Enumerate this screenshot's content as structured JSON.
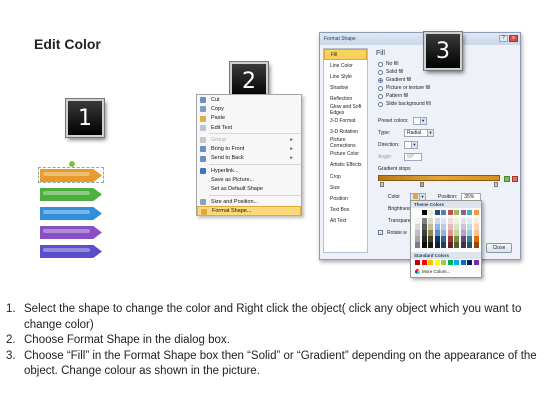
{
  "title": "Edit Color",
  "steps": [
    "1",
    "2",
    "3"
  ],
  "shapes": {
    "colors": [
      "#e89a2c",
      "#4caf3e",
      "#2f8fd8",
      "#8a4fc4",
      "#5a4fc8"
    ]
  },
  "context_menu": {
    "items": [
      {
        "label": "Cut",
        "icon_color": "#6a8fc7",
        "disabled": false,
        "submenu": false,
        "highlight": false
      },
      {
        "label": "Copy",
        "icon_color": "#7d9cc8",
        "disabled": false,
        "submenu": false,
        "highlight": false
      },
      {
        "label": "Paste",
        "icon_color": "#d9b14a",
        "disabled": false,
        "submenu": false,
        "highlight": false
      },
      {
        "label": "Edit Text",
        "icon_color": "#b7c4d8",
        "disabled": false,
        "submenu": false,
        "highlight": false
      },
      {
        "label": "Group",
        "icon_color": "#c8c8c8",
        "disabled": true,
        "submenu": true,
        "highlight": false
      },
      {
        "label": "Bring to Front",
        "icon_color": "#6d8fbf",
        "disabled": false,
        "submenu": true,
        "highlight": false
      },
      {
        "label": "Send to Back",
        "icon_color": "#6d8fbf",
        "disabled": false,
        "submenu": true,
        "highlight": false
      },
      {
        "label": "Hyperlink...",
        "icon_color": "#3b73c6",
        "disabled": false,
        "submenu": false,
        "highlight": false
      },
      {
        "label": "Save as Picture...",
        "icon_color": "",
        "disabled": false,
        "submenu": false,
        "highlight": false
      },
      {
        "label": "Set as Default Shape",
        "icon_color": "",
        "disabled": false,
        "submenu": false,
        "highlight": false
      },
      {
        "label": "Size and Position...",
        "icon_color": "#8aa3c5",
        "disabled": false,
        "submenu": false,
        "highlight": false
      },
      {
        "label": "Format Shape...",
        "icon_color": "#e1a83a",
        "disabled": false,
        "submenu": false,
        "highlight": true
      }
    ]
  },
  "dialog": {
    "title": "Format Shape",
    "close_glyph": "x",
    "categories": [
      "Fill",
      "Line Color",
      "Line Style",
      "Shadow",
      "Reflection",
      "Glow and Soft Edges",
      "3-D Format",
      "3-D Rotation",
      "Picture Corrections",
      "Picture Color",
      "Artistic Effects",
      "Crop",
      "Size",
      "Position",
      "Text Box",
      "Alt Text"
    ],
    "selected_category": "Fill",
    "panel_heading": "Fill",
    "fill_options": [
      {
        "label": "No fill",
        "selected": false
      },
      {
        "label": "Solid fill",
        "selected": false
      },
      {
        "label": "Gradient fill",
        "selected": true
      },
      {
        "label": "Picture or texture fill",
        "selected": false
      },
      {
        "label": "Pattern fill",
        "selected": false
      },
      {
        "label": "Slide background fill",
        "selected": false
      }
    ],
    "preset_colors_label": "Preset colors:",
    "type_label": "Type:",
    "type_value": "Radial",
    "direction_label": "Direction:",
    "angle_label": "Angle:",
    "angle_value": "90°",
    "gradient_stops_label": "Gradient stops",
    "color_label": "Color",
    "position_label": "Position:",
    "position_value": "35%",
    "brightness_label": "Brightness:",
    "transparency_label": "Transparency:",
    "rotate_label": "Rotate w",
    "close_label": "Close"
  },
  "palette": {
    "theme_label": "Theme Colors",
    "theme_top": [
      "#ffffff",
      "#000000",
      "#eeece1",
      "#1f497d",
      "#4f81bd",
      "#c0504d",
      "#9bbb59",
      "#8064a2",
      "#4bacc6",
      "#f79646"
    ],
    "theme_tint_columns": [
      [
        "#f2f2f2",
        "#d8d8d8",
        "#bfbfbf",
        "#a5a5a5",
        "#7f7f7f"
      ],
      [
        "#7f7f7f",
        "#595959",
        "#3f3f3f",
        "#262626",
        "#0c0c0c"
      ],
      [
        "#ddd9c3",
        "#c4bd97",
        "#938953",
        "#494429",
        "#1d1b10"
      ],
      [
        "#c6d9f0",
        "#8db3e2",
        "#548dd4",
        "#17365d",
        "#0f243e"
      ],
      [
        "#dbe5f1",
        "#b8cce4",
        "#95b3d7",
        "#366092",
        "#244061"
      ],
      [
        "#f2dcdb",
        "#e5b9b7",
        "#d99694",
        "#953734",
        "#632423"
      ],
      [
        "#ebf1dd",
        "#d7e3bc",
        "#c3d69b",
        "#76923c",
        "#4f6128"
      ],
      [
        "#e5e0ec",
        "#ccc1d9",
        "#b2a2c7",
        "#5f497a",
        "#3f3151"
      ],
      [
        "#dbeef3",
        "#b7dde8",
        "#92cddc",
        "#31859b",
        "#205867"
      ],
      [
        "#fdeada",
        "#fbd5b5",
        "#fac08f",
        "#e36c09",
        "#974806"
      ]
    ],
    "standard_label": "Standard Colors",
    "standard": [
      "#c00000",
      "#ff0000",
      "#ffc000",
      "#ffff00",
      "#92d050",
      "#00b050",
      "#00b0f0",
      "#0070c0",
      "#002060",
      "#7030a0"
    ],
    "more_label": "More Colors..."
  },
  "instructions": [
    {
      "num": "1.",
      "text": "Select the shape to change the color and Right click the object( click any object which you want to change color)"
    },
    {
      "num": "2.",
      "text": "Choose Format Shape in the dialog box."
    },
    {
      "num": "3.",
      "text": "Choose “Fill” in the Format Shape box then “Solid” or “Gradient” depending on the appearance of the object. Change colour as shown in the picture."
    }
  ]
}
